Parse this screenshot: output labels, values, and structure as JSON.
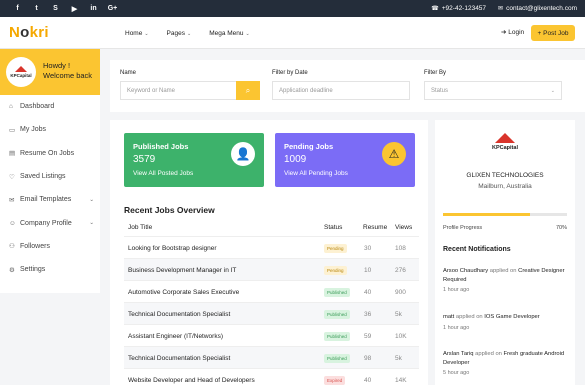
{
  "topbar": {
    "social": [
      {
        "icon": "facebook-icon",
        "glyph": "f"
      },
      {
        "icon": "twitter-icon",
        "glyph": "t"
      },
      {
        "icon": "skype-icon",
        "glyph": "S"
      },
      {
        "icon": "youtube-icon",
        "glyph": "▶"
      },
      {
        "icon": "linkedin-icon",
        "glyph": "in"
      },
      {
        "icon": "google-plus-icon",
        "glyph": "G+"
      }
    ],
    "phone": "+92-42-123457",
    "email": "contact@glixentech.com"
  },
  "navbar": {
    "logo_prefix": "N",
    "logo_mid": "o",
    "logo_suffix": "kri",
    "menu": [
      "Home",
      "Pages",
      "Mega Menu"
    ],
    "login": "Login",
    "post_job": "Post Job"
  },
  "sidebar": {
    "howdy": "Howdy !",
    "welcome": "Welcome back",
    "avatar_text": "KPCapital",
    "items": [
      {
        "label": "Dashboard",
        "icon": "home-icon",
        "glyph": "⌂",
        "arrow": false
      },
      {
        "label": "My Jobs",
        "icon": "briefcase-icon",
        "glyph": "▭",
        "arrow": false
      },
      {
        "label": "Resume On Jobs",
        "icon": "document-icon",
        "glyph": "▤",
        "arrow": false
      },
      {
        "label": "Saved Listings",
        "icon": "heart-icon",
        "glyph": "♡",
        "arrow": false
      },
      {
        "label": "Email Templates",
        "icon": "envelope-icon",
        "glyph": "✉",
        "arrow": true
      },
      {
        "label": "Company Profile",
        "icon": "user-icon",
        "glyph": "☺",
        "arrow": true
      },
      {
        "label": "Followers",
        "icon": "users-icon",
        "glyph": "⚇",
        "arrow": false
      },
      {
        "label": "Settings",
        "icon": "gear-icon",
        "glyph": "⚙",
        "arrow": false
      }
    ]
  },
  "filter": {
    "name_label": "Name",
    "name_placeholder": "Keyword or Name",
    "date_label": "Filter by Date",
    "date_placeholder": "Application deadline",
    "status_label": "Filter By",
    "status_placeholder": "Status"
  },
  "cards": {
    "published": {
      "title": "Published Jobs",
      "count": "3579",
      "link": "View All Posted Jobs",
      "color": "#3db26b"
    },
    "pending": {
      "title": "Pending Jobs",
      "count": "1009",
      "link": "View All Pending Jobs",
      "color": "#7b6cf6"
    }
  },
  "overview": {
    "title": "Recent Jobs Overview",
    "headers": {
      "title": "Job Title",
      "status": "Status",
      "resume": "Resume",
      "views": "Views"
    },
    "rows": [
      {
        "title": "Looking for Bootstrap designer",
        "status": "Pending",
        "kind": "pend",
        "resume": "30",
        "views": "108"
      },
      {
        "title": "Business Development Manager in IT",
        "status": "Pending",
        "kind": "pend",
        "resume": "10",
        "views": "276"
      },
      {
        "title": "Automotive Corporate Sales Executive",
        "status": "Published",
        "kind": "pub",
        "resume": "40",
        "views": "900"
      },
      {
        "title": "Technical Documentation Specialist",
        "status": "Published",
        "kind": "pub",
        "resume": "36",
        "views": "5k"
      },
      {
        "title": "Assistant Engineer (IT/Networks)",
        "status": "Published",
        "kind": "pub",
        "resume": "59",
        "views": "10K"
      },
      {
        "title": "Technical Documentation Specialist",
        "status": "Published",
        "kind": "pub",
        "resume": "98",
        "views": "5k"
      },
      {
        "title": "Website Developer and Head of Developers",
        "status": "Expired",
        "kind": "exp",
        "resume": "40",
        "views": "14K"
      }
    ]
  },
  "company": {
    "logo_text": "KPCapital",
    "name": "GLIXEN TECHNOLOGIES",
    "location": "Mailburn, Australia",
    "progress_label": "Profile Progress",
    "progress_text": "70%",
    "progress_value": 0.7
  },
  "notifications": {
    "title": "Recent Notifications",
    "items": [
      {
        "name": "Arsoo Chaudhary",
        "action": "applied on",
        "target": "Creative Designer Required",
        "time": "1 hour ago"
      },
      {
        "name": "matt",
        "action": "applied on",
        "target": "IOS Game Developer",
        "time": "1 hour ago"
      },
      {
        "name": "Arslan Tariq",
        "action": "applied on",
        "target": "Fresh graduate Android Developer",
        "time": "5 hour ago"
      }
    ]
  }
}
